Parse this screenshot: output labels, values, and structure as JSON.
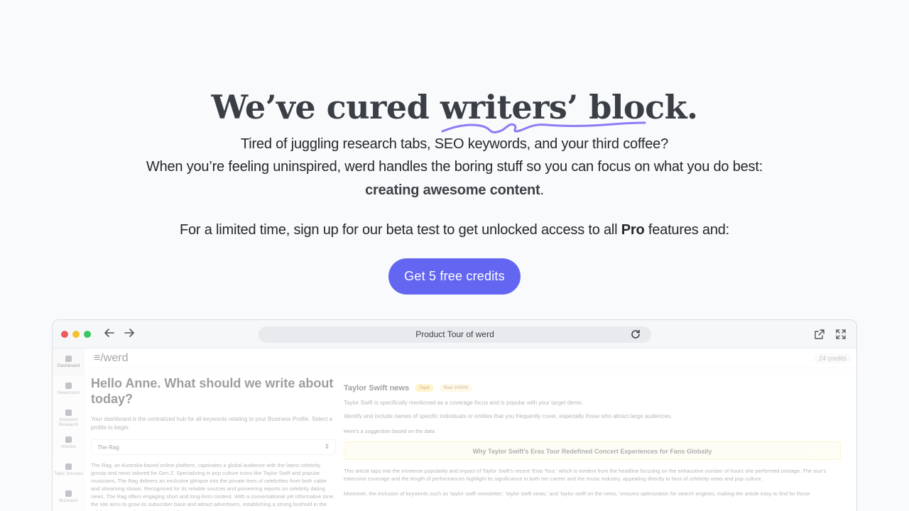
{
  "hero": {
    "headline_lead": "We’ve cured ",
    "headline_emph": "writers’ block",
    "headline_end": ".",
    "line1": "Tired of juggling research tabs, SEO keywords, and your third coffee?",
    "line2": "When you’re feeling uninspired, werd handles the boring stuff so you can focus on what you do best:",
    "line3_bold": "creating awesome content",
    "line3_end": ".",
    "line4_lead": "For a limited time, sign up for our beta test to get unlocked access to all ",
    "line4_bold": "Pro",
    "line4_end": " features and:",
    "cta_label": "Get 5 free credits"
  },
  "colors": {
    "accent": "#6366f1",
    "squiggle": "#8b7cf6"
  },
  "browser": {
    "url_label": "Product Tour of werd",
    "icons": [
      "back-arrow-icon",
      "forward-arrow-icon",
      "reload-icon",
      "external-link-icon",
      "fullscreen-icon"
    ]
  },
  "app": {
    "logo": "≡/werd",
    "credits": "24 credits",
    "sidebar": [
      {
        "label": "Dashboard",
        "icon": "grid-icon"
      },
      {
        "label": "Newsroom",
        "icon": "megaphone-icon"
      },
      {
        "label": "Keyword Research",
        "icon": "chart-icon"
      },
      {
        "label": "Articles",
        "icon": "document-icon"
      },
      {
        "label": "Topic Sources",
        "icon": "monitor-icon"
      },
      {
        "label": "Business",
        "icon": "building-icon"
      }
    ],
    "hello": "Hello Anne. What should we write about today?",
    "hello_desc": "Your dashboard is the centralized hub for all keywords relating to your Business Profile. Select a profile to begin.",
    "profile_select": "The Rag",
    "profile_desc": "The Rag, an Australia-based online platform, captivates a global audience with the latest celebrity gossip and news tailored for Gen Z. Specializing in pop culture icons like Taylor Swift and popular musicians, The Rag delivers an exclusive glimpse into the private lives of celebrities from both cable and streaming shows. Recognized for its reliable sources and pioneering reports on celebrity dating news, The Rag offers engaging short and long-form content. With a conversational yet informative tone, the site aims to grow its subscriber base and attract advertisers, establishing a strong foothold in the celebrity news and entertainment niche.",
    "topic_title": "Taylor Swift news",
    "tag_a": "Topic",
    "tag_b": "Rise 1000%",
    "topic_desc": "Taylor Swift is specifically mentioned as a coverage focus and is popular with your target demo.",
    "topic_desc2": "Identify and include names of specific individuals or entities that you frequently cover, especially those who attract large audiences.",
    "suggestion_label": "Here's a suggestion based on the data",
    "suggestion_title": "Why Taylor Swift's Eras Tour Redefined Concert Experiences for Fans Globally",
    "article_p1": "This article taps into the immense popularity and impact of Taylor Swift's recent 'Eras Tour,' which is evident from the headline focusing on the exhaustive number of hours she performed onstage. The tour's extensive coverage and the length of performances highlight its significance in both her career and the music industry, appealing directly to fans of celebrity news and pop culture.",
    "article_p2": "Moreover, the inclusion of keywords such as 'taylor swift newsletter,' 'taylor swift news,' and 'taylor swift on the news,' ensures optimization for search engines, making the article easy to find for those"
  }
}
